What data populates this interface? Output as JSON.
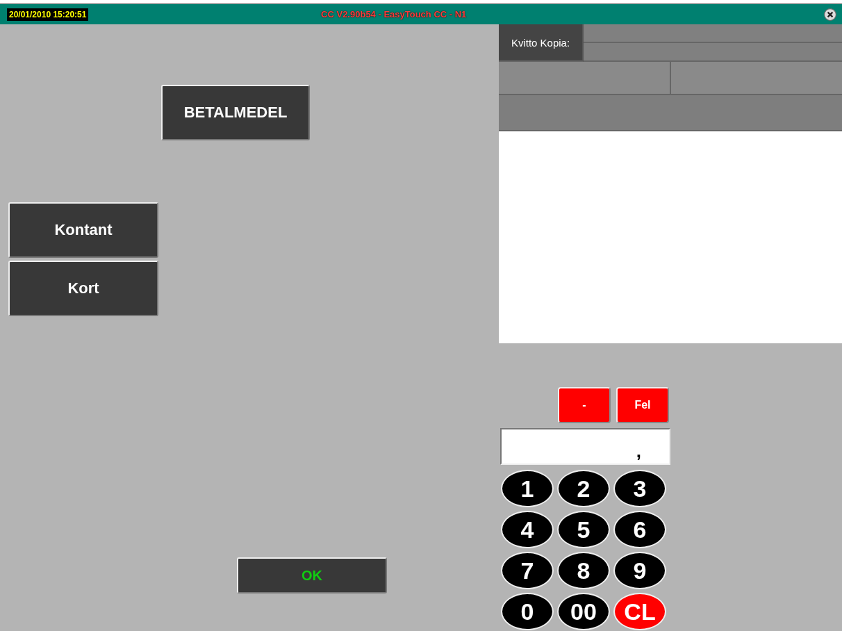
{
  "title_bar": {
    "datetime": "20/01/2010 15:20:51",
    "title": "CC V2.90b54 - EasyTouch CC - N1"
  },
  "left": {
    "category_button": "BETALMEDEL",
    "payment_buttons": [
      "Kontant",
      "Kort"
    ],
    "ok_button": "OK"
  },
  "receipt": {
    "label": "Kvitto Kopia:"
  },
  "keypad": {
    "top_buttons": [
      "-",
      "Fel"
    ],
    "display": {
      "value": ","
    },
    "keys": [
      {
        "label": "1",
        "kind": "digit"
      },
      {
        "label": "2",
        "kind": "digit"
      },
      {
        "label": "3",
        "kind": "digit"
      },
      {
        "label": "4",
        "kind": "digit"
      },
      {
        "label": "5",
        "kind": "digit"
      },
      {
        "label": "6",
        "kind": "digit"
      },
      {
        "label": "7",
        "kind": "digit"
      },
      {
        "label": "8",
        "kind": "digit"
      },
      {
        "label": "9",
        "kind": "digit"
      },
      {
        "label": "0",
        "kind": "digit"
      },
      {
        "label": "00",
        "kind": "digit"
      },
      {
        "label": "CL",
        "kind": "clear"
      }
    ]
  }
}
